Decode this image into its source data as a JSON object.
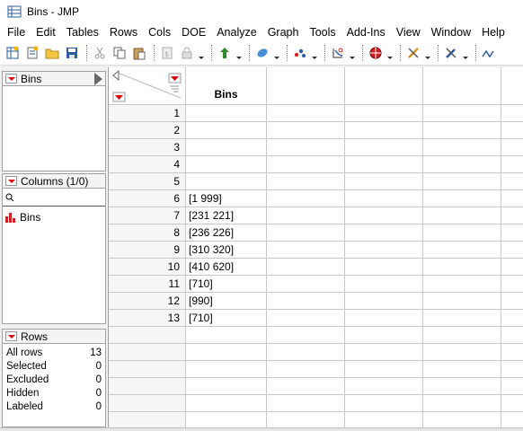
{
  "window": {
    "title": "Bins - JMP"
  },
  "menubar": [
    "File",
    "Edit",
    "Tables",
    "Rows",
    "Cols",
    "DOE",
    "Analyze",
    "Graph",
    "Tools",
    "Add-Ins",
    "View",
    "Window",
    "Help"
  ],
  "toolbar": {
    "icons": [
      "new-data-table-icon",
      "new-script-icon",
      "open-icon",
      "save-icon",
      "cut-icon",
      "copy-icon",
      "paste-icon",
      "copy-script-icon",
      "lock-icon",
      "add-row-icon",
      "select-tool-icon",
      "brush-tool-icon",
      "lasso-tool-icon",
      "crosshair-tool-icon",
      "hand-tool-icon",
      "tools-icon",
      "connect-icon"
    ]
  },
  "left_panel": {
    "table_panel": {
      "label": "Bins"
    },
    "columns_panel": {
      "label": "Columns (1/0)",
      "search_placeholder": "",
      "columns": [
        {
          "name": "Bins",
          "icon": "nominal-icon"
        }
      ]
    },
    "rows_panel": {
      "label": "Rows",
      "stats": [
        {
          "label": "All rows",
          "value": "13"
        },
        {
          "label": "Selected",
          "value": "0"
        },
        {
          "label": "Excluded",
          "value": "0"
        },
        {
          "label": "Hidden",
          "value": "0"
        },
        {
          "label": "Labeled",
          "value": "0"
        }
      ]
    }
  },
  "grid": {
    "columns": [
      "Bins"
    ],
    "rows": [
      {
        "n": "1",
        "Bins": ""
      },
      {
        "n": "2",
        "Bins": ""
      },
      {
        "n": "3",
        "Bins": ""
      },
      {
        "n": "4",
        "Bins": ""
      },
      {
        "n": "5",
        "Bins": ""
      },
      {
        "n": "6",
        "Bins": "[1 999]"
      },
      {
        "n": "7",
        "Bins": "[231 221]"
      },
      {
        "n": "8",
        "Bins": "[236 226]"
      },
      {
        "n": "9",
        "Bins": "[310 320]"
      },
      {
        "n": "10",
        "Bins": "[410 620]"
      },
      {
        "n": "11",
        "Bins": "[710]"
      },
      {
        "n": "12",
        "Bins": "[990]"
      },
      {
        "n": "13",
        "Bins": "[710]"
      }
    ]
  },
  "colors": {
    "disclosure_red": "#dd0000",
    "grid_line": "#c8c8c8",
    "panel_border": "#a0a0a0"
  }
}
